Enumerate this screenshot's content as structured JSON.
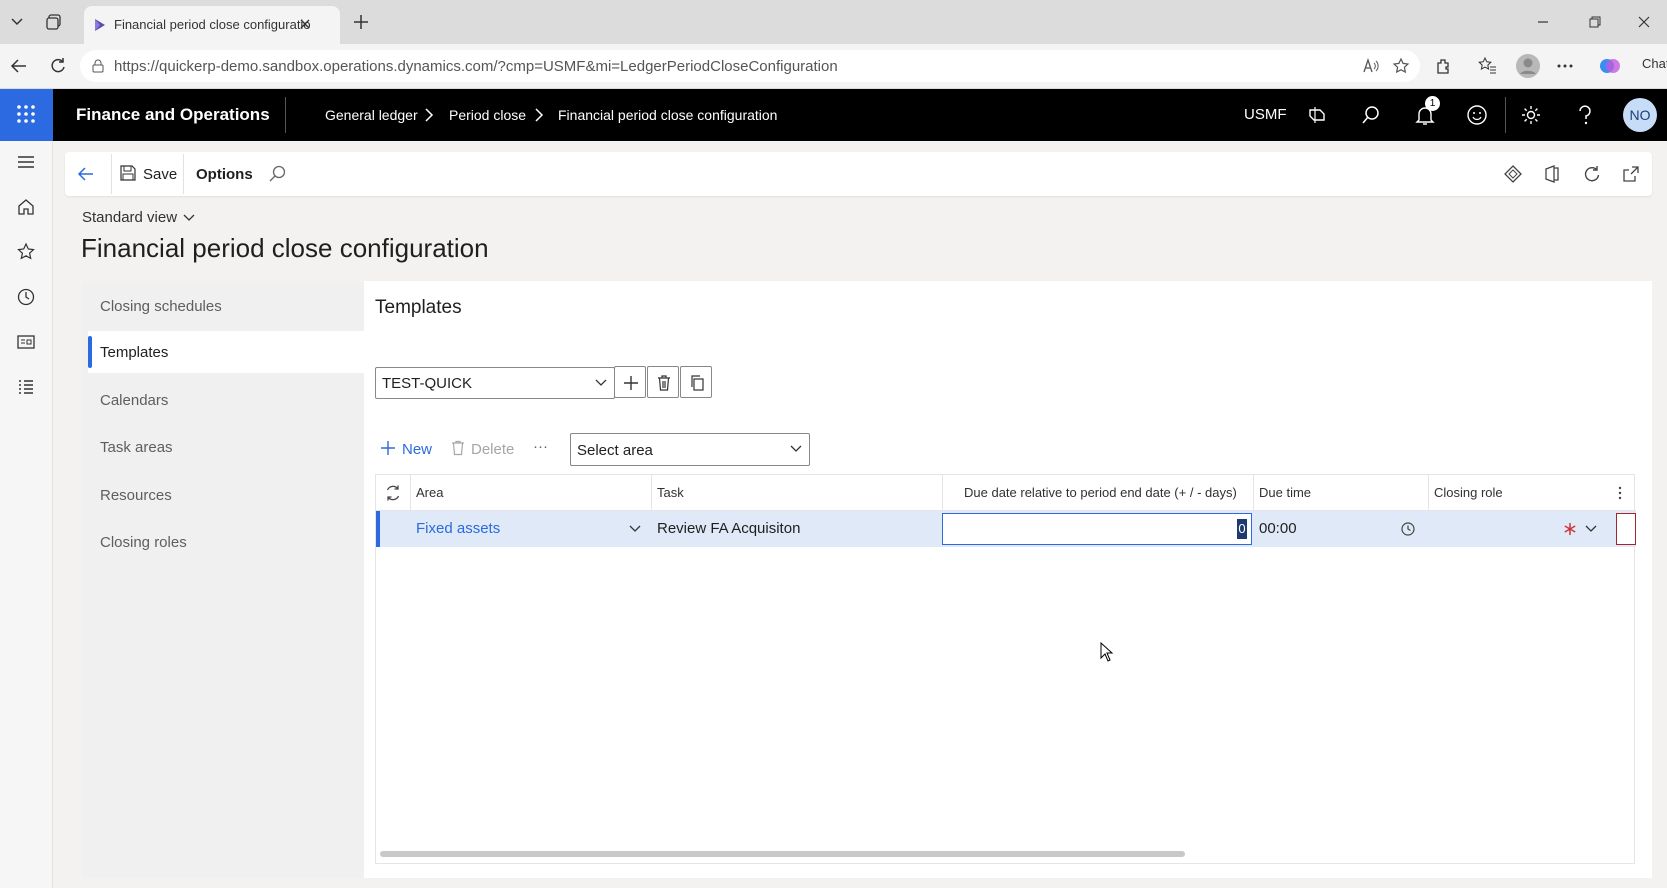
{
  "browser": {
    "tab_title": "Financial period close configuratio",
    "url": "https://quickerp-demo.sandbox.operations.dynamics.com/?cmp=USMF&mi=LedgerPeriodCloseConfiguration",
    "chat_label": "Chat"
  },
  "appbar": {
    "title": "Finance and Operations",
    "breadcrumbs": [
      "General ledger",
      "Period close",
      "Financial period close configuration"
    ],
    "company": "USMF",
    "notification_count": "1",
    "avatar_initials": "NO"
  },
  "actionbar": {
    "save_label": "Save",
    "options_label": "Options"
  },
  "page": {
    "view_label": "Standard view",
    "title": "Financial period close configuration"
  },
  "subnav": {
    "items": [
      {
        "label": "Closing schedules"
      },
      {
        "label": "Templates"
      },
      {
        "label": "Calendars"
      },
      {
        "label": "Task areas"
      },
      {
        "label": "Resources"
      },
      {
        "label": "Closing roles"
      }
    ],
    "active": "Templates"
  },
  "templates": {
    "section_title": "Templates",
    "selected_template": "TEST-QUICK",
    "toolbar": {
      "new_label": "New",
      "delete_label": "Delete",
      "more_label": "···",
      "area_select_placeholder": "Select area"
    },
    "grid": {
      "columns": [
        "Area",
        "Task",
        "Due date relative to period end date (+ / - days)",
        "Due time",
        "Closing role"
      ],
      "rows": [
        {
          "area": "Fixed assets",
          "task": "Review FA Acquisiton",
          "due_days": "0",
          "due_time": "00:00",
          "closing_role": ""
        }
      ]
    }
  },
  "colors": {
    "accent": "#2b6ae0",
    "appbar_bg": "#000000",
    "selected_row": "#dfe9f7",
    "required": "#d13438"
  }
}
